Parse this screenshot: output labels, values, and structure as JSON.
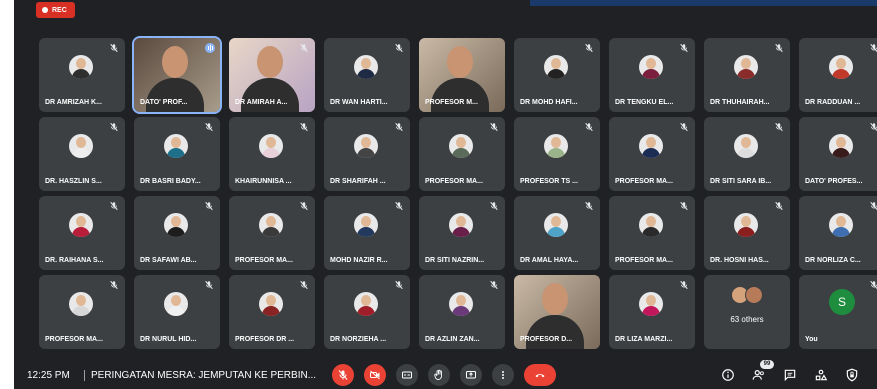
{
  "recording_label": "REC",
  "tiles": [
    {
      "name": "DR AMRIZAH K...",
      "type": "avatar",
      "muted": true,
      "shirt": "#2f2f2f"
    },
    {
      "name": "DATO' PROF...",
      "type": "video",
      "muted": false,
      "speaking": true,
      "active": true
    },
    {
      "name": "DR AMIRAH A...",
      "type": "video",
      "muted": true
    },
    {
      "name": "DR WAN HARTI...",
      "type": "avatar",
      "muted": true,
      "shirt": "#1f2a44"
    },
    {
      "name": "PROFESOR M...",
      "type": "video",
      "muted": false
    },
    {
      "name": "DR MOHD HAFI...",
      "type": "avatar",
      "muted": true,
      "shirt": "#222222"
    },
    {
      "name": "DR TENGKU EL...",
      "type": "avatar",
      "muted": true,
      "shirt": "#7a1f3d"
    },
    {
      "name": "DR THUHAIRAH...",
      "type": "avatar",
      "muted": true,
      "shirt": "#8a2c2c"
    },
    {
      "name": "DR RADDUAN ...",
      "type": "avatar",
      "muted": true,
      "shirt": "#c0392b"
    },
    {
      "name": "DR. HASZLIN S...",
      "type": "avatar",
      "muted": true,
      "shirt": "#eeeeee"
    },
    {
      "name": "DR BASRI BADY...",
      "type": "avatar",
      "muted": true,
      "shirt": "#1d6f8a"
    },
    {
      "name": "KHAIRUNNISA ...",
      "type": "avatar",
      "muted": true,
      "shirt": "#e7d0d8"
    },
    {
      "name": "DR SHARIFAH ...",
      "type": "avatar",
      "muted": true,
      "shirt": "#444444"
    },
    {
      "name": "PROFESOR MA...",
      "type": "avatar",
      "muted": true,
      "shirt": "#5a6b5a"
    },
    {
      "name": "PROFESOR TS ...",
      "type": "avatar",
      "muted": true,
      "shirt": "#9ab38a"
    },
    {
      "name": "PROFESOR MA...",
      "type": "avatar",
      "muted": true,
      "shirt": "#1b2c55"
    },
    {
      "name": "DR SITI SARA IB...",
      "type": "avatar",
      "muted": true,
      "shirt": "#dddddd"
    },
    {
      "name": "DATO' PROFES...",
      "type": "avatar",
      "muted": true,
      "shirt": "#3a1b1b"
    },
    {
      "name": "DR. RAIHANA S...",
      "type": "avatar",
      "muted": true,
      "shirt": "#b81d3a"
    },
    {
      "name": "DR SAFAWI AB...",
      "type": "avatar",
      "muted": true,
      "shirt": "#1d1d1d"
    },
    {
      "name": "PROFESOR MA...",
      "type": "avatar",
      "muted": true,
      "shirt": "#3a3a3a"
    },
    {
      "name": "MOHD NAZIR R...",
      "type": "avatar",
      "muted": true,
      "shirt": "#23395d"
    },
    {
      "name": "DR SITI NAZRIN...",
      "type": "avatar",
      "muted": true,
      "shirt": "#6a1f4a"
    },
    {
      "name": "DR AMAL HAYA...",
      "type": "avatar",
      "muted": true,
      "shirt": "#4fa3c7"
    },
    {
      "name": "PROFESOR MA...",
      "type": "avatar",
      "muted": true,
      "shirt": "#2a2a2a"
    },
    {
      "name": "DR. HOSNI HAS...",
      "type": "avatar",
      "muted": true,
      "shirt": "#8b1e1e"
    },
    {
      "name": "DR NORLIZA C...",
      "type": "avatar",
      "muted": true,
      "shirt": "#3f6fb0"
    },
    {
      "name": "PROFESOR MA...",
      "type": "avatar",
      "muted": true,
      "shirt": "#d7d7d7"
    },
    {
      "name": "DR NURUL HID...",
      "type": "avatar",
      "muted": true,
      "shirt": "#f0f0f0"
    },
    {
      "name": "PROFESOR DR ...",
      "type": "avatar",
      "muted": true,
      "shirt": "#8a2323"
    },
    {
      "name": "DR NORZIEHA ...",
      "type": "avatar",
      "muted": true,
      "shirt": "#a01e2a"
    },
    {
      "name": "DR AZLIN ZAN...",
      "type": "avatar",
      "muted": true,
      "shirt": "#6b3a7a"
    },
    {
      "name": "PROFESOR D...",
      "type": "video",
      "muted": false
    },
    {
      "name": "DR LIZA MARZI...",
      "type": "avatar",
      "muted": true,
      "shirt": "#c2185b"
    },
    {
      "name": "",
      "type": "others",
      "muted": false,
      "count_label": "63 others"
    },
    {
      "name": "You",
      "type": "you",
      "muted": true,
      "initial": "S"
    }
  ],
  "bottom_bar": {
    "time": "12:25 PM",
    "meeting_title": "PERINGATAN MESRA: JEMPUTAN KE PERBIN...",
    "participants_badge": "99"
  },
  "colors": {
    "app_bg": "#202124",
    "tile_bg": "#3c4043",
    "danger": "#ea4335",
    "accent": "#8ab4f8"
  }
}
